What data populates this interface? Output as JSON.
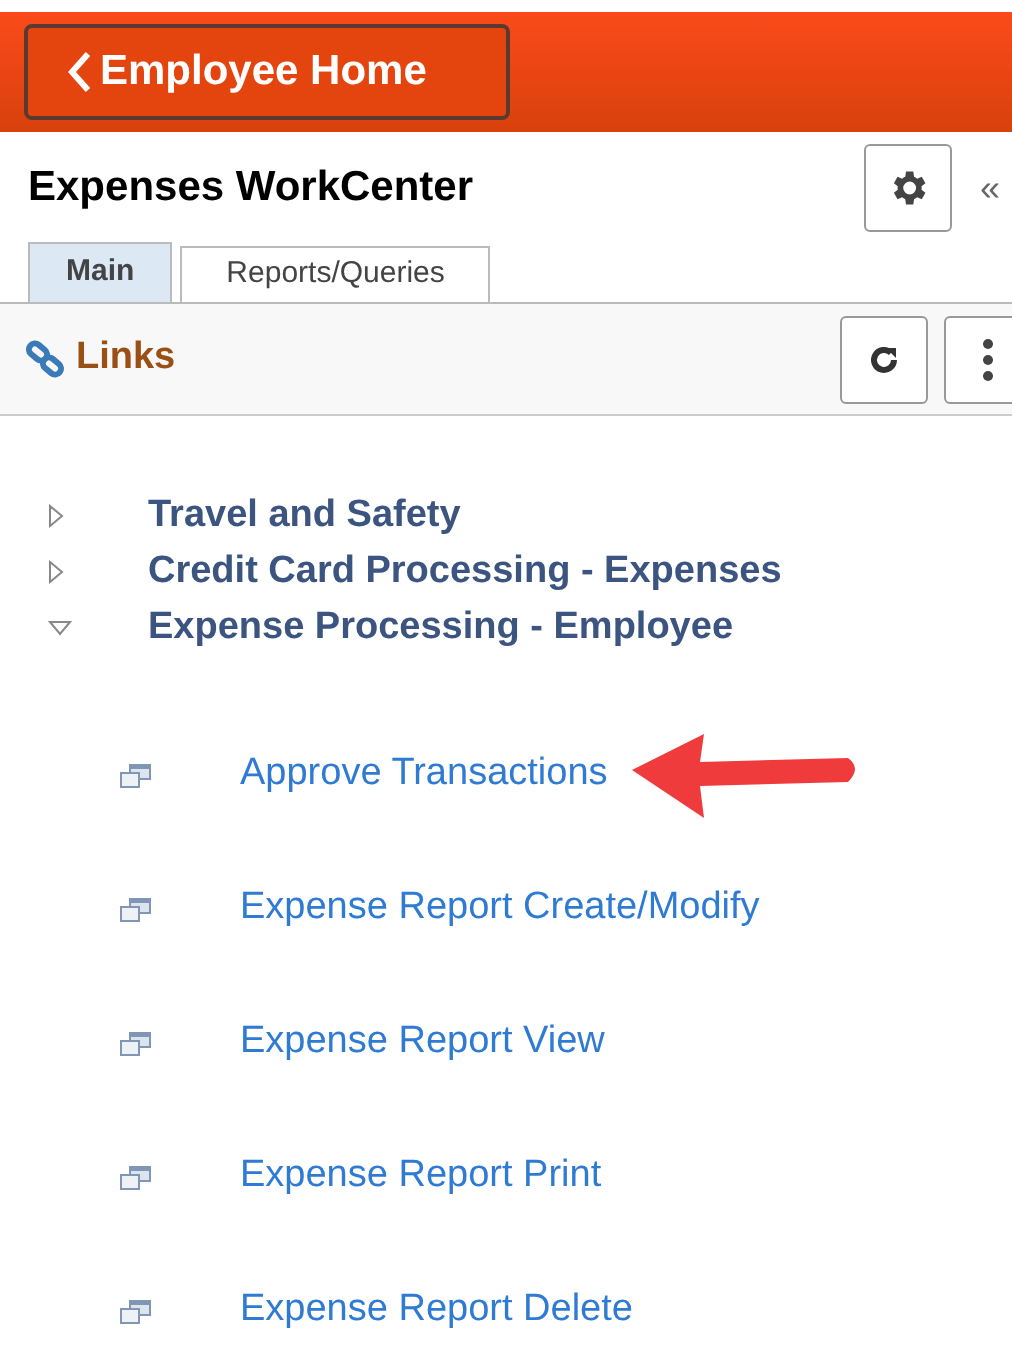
{
  "header": {
    "back_button": "Employee Home"
  },
  "workcenter": {
    "title": "Expenses WorkCenter",
    "collapse_button": "«"
  },
  "tabs": [
    {
      "label": "Main",
      "selected": true
    },
    {
      "label": "Reports/Queries",
      "selected": false
    }
  ],
  "links_section": {
    "title": "Links"
  },
  "tree": [
    {
      "label": "Travel and Safety",
      "expanded": false
    },
    {
      "label": "Credit Card Processing - Expenses",
      "expanded": false
    },
    {
      "label": "Expense Processing - Employee",
      "expanded": true,
      "children": [
        {
          "label": "Approve Transactions",
          "highlighted": true
        },
        {
          "label": "Expense Report Create/Modify",
          "highlighted": false
        },
        {
          "label": "Expense Report View",
          "highlighted": false
        },
        {
          "label": "Expense Report Print",
          "highlighted": false
        },
        {
          "label": "Expense Report Delete",
          "highlighted": false
        }
      ]
    }
  ]
}
